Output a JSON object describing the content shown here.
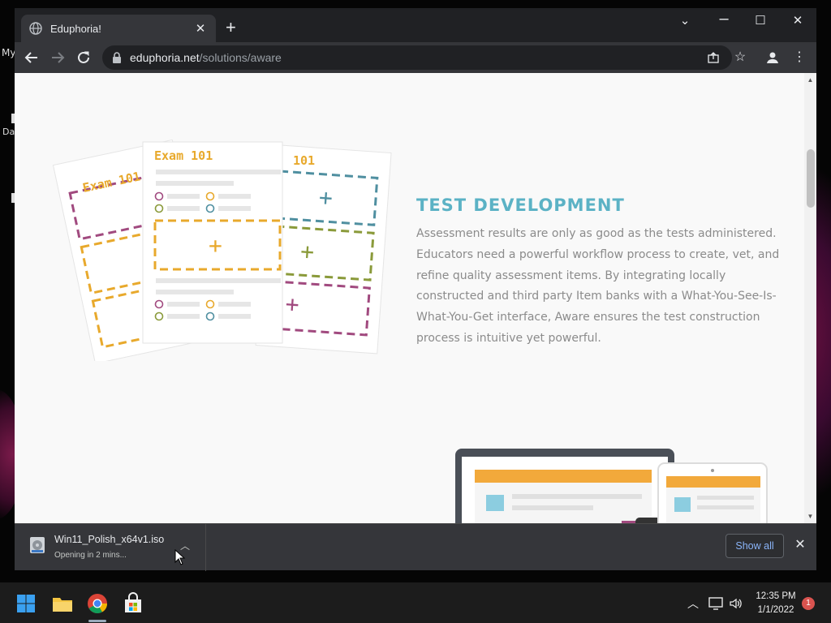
{
  "desktop": {
    "label_1": "My",
    "label_2": "Da"
  },
  "browser": {
    "tab": {
      "title": "Eduphoria!",
      "icon": "globe-icon"
    },
    "address": {
      "host": "eduphoria.net",
      "path": "/solutions/aware"
    },
    "icons": {
      "new_tab": "plus-icon",
      "back": "back-arrow-icon",
      "forward": "forward-arrow-icon",
      "reload": "reload-icon",
      "lock": "lock-icon",
      "share": "share-icon",
      "bookmark": "star-icon",
      "profile": "profile-icon",
      "menu": "kebab-menu-icon"
    }
  },
  "page": {
    "section": {
      "title": "TEST DEVELOPMENT",
      "body": "Assessment results are only as good as the tests administered. Educators need a powerful workflow process to create, vet, and refine quality assessment items. By integrating locally constructed and third party Item banks with a What-You-See-Is-What-You-Get interface, Aware ensures the test construction process is intuitive yet powerful."
    },
    "illustration": {
      "label_left": "Exam 101",
      "label_center": "Exam 101",
      "label_right": "101",
      "colors": {
        "orange": "#e8a92c",
        "purple": "#a14a7f",
        "teal": "#4f8fa0",
        "olive": "#8a9a3a"
      }
    },
    "scroll_position": 0.17
  },
  "download": {
    "file_name": "Win11_Polish_x64v1.iso",
    "status": "Opening in 2 mins...",
    "show_all_label": "Show all"
  },
  "taskbar": {
    "apps": [
      "windows-start-icon",
      "file-explorer-icon",
      "chrome-icon",
      "store-icon"
    ],
    "time": "12:35 PM",
    "date": "1/1/2022",
    "notification_count": "1"
  },
  "colors": {
    "accent_title": "#5bb2c5",
    "body_text": "#8b8b8b",
    "chrome_dark": "#202124",
    "chrome_toolbar": "#35363a",
    "link_blue": "#8ab4f8"
  }
}
